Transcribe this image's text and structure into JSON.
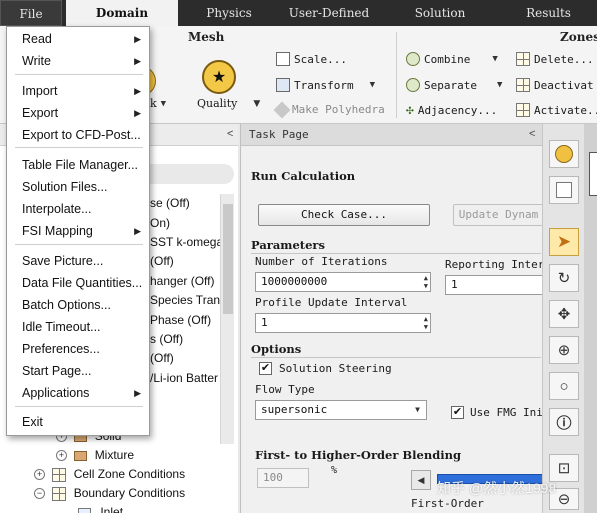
{
  "menubar": {
    "tabs": [
      "File",
      "Domain",
      "Physics",
      "User-Defined",
      "Solution",
      "Results"
    ],
    "active_tab": "Domain"
  },
  "ribbon": {
    "mesh_group_title": "Mesh",
    "zones_group_title": "Zones",
    "quality_label": "Quality",
    "partial_label": "k",
    "scale_label": "Scale...",
    "transform_label": "Transform",
    "make_polyhedra_label": "Make Polyhedra",
    "combine_label": "Combine",
    "separate_label": "Separate",
    "adjacency_label": "Adjacency...",
    "delete_label": "Delete...",
    "deactivate_label": "Deactivat",
    "activate_label": "Activate..."
  },
  "file_menu": {
    "items": [
      {
        "label": "Read",
        "submenu": true
      },
      {
        "label": "Write",
        "submenu": true
      },
      {
        "label": "Import",
        "submenu": true
      },
      {
        "label": "Export",
        "submenu": true
      },
      {
        "label": "Export to CFD-Post...",
        "submenu": false
      },
      {
        "label": "Table File Manager...",
        "submenu": false
      },
      {
        "label": "Solution Files...",
        "submenu": false
      },
      {
        "label": "Interpolate...",
        "submenu": false
      },
      {
        "label": "FSI Mapping",
        "submenu": true
      },
      {
        "label": "Save Picture...",
        "submenu": false
      },
      {
        "label": "Data File Quantities...",
        "submenu": false
      },
      {
        "label": "Batch Options...",
        "submenu": false
      },
      {
        "label": "Idle Timeout...",
        "submenu": false
      },
      {
        "label": "Preferences...",
        "submenu": false
      },
      {
        "label": "Start Page...",
        "submenu": false
      },
      {
        "label": "Applications",
        "submenu": true
      },
      {
        "label": "Exit",
        "submenu": false
      }
    ],
    "submenu_arrow": "▶"
  },
  "tree": {
    "collapse_arrow": "<",
    "partial_rows": [
      "se (Off)",
      "On)",
      "SST k-omega",
      "(Off)",
      "hanger (Off)",
      "Species Trans",
      "Phase (Off)",
      "s (Off)",
      "(Off)",
      "/Li-ion Batter"
    ],
    "solid_label": "Solid",
    "mixture_label": "Mixture",
    "cell_zone_label": "Cell Zone Conditions",
    "boundary_label": "Boundary Conditions",
    "inlet_label": "Inlet"
  },
  "task_page": {
    "title": "Task Page",
    "collapse_arrow": "<",
    "section_title": "Run Calculation",
    "check_case_label": "Check Case...",
    "update_dynamic_label": "Update Dynam",
    "parameters_title": "Parameters",
    "iterations_label": "Number of Iterations",
    "iterations_value": "1000000000",
    "reporting_label": "Reporting Interv",
    "reporting_value": "1",
    "profile_label": "Profile Update Interval",
    "profile_value": "1",
    "options_title": "Options",
    "solution_steering_label": "Solution Steering",
    "solution_steering_checked": true,
    "flow_type_label": "Flow Type",
    "flow_type_value": "supersonic",
    "fmg_label": "Use FMG Ini",
    "fmg_checked": true,
    "blending_title": "First- to Higher-Order Blending",
    "percent_symbol": "%",
    "blending_value": "100",
    "first_order_label": "First-Order"
  },
  "watermark": "知乎 @然小然1998"
}
